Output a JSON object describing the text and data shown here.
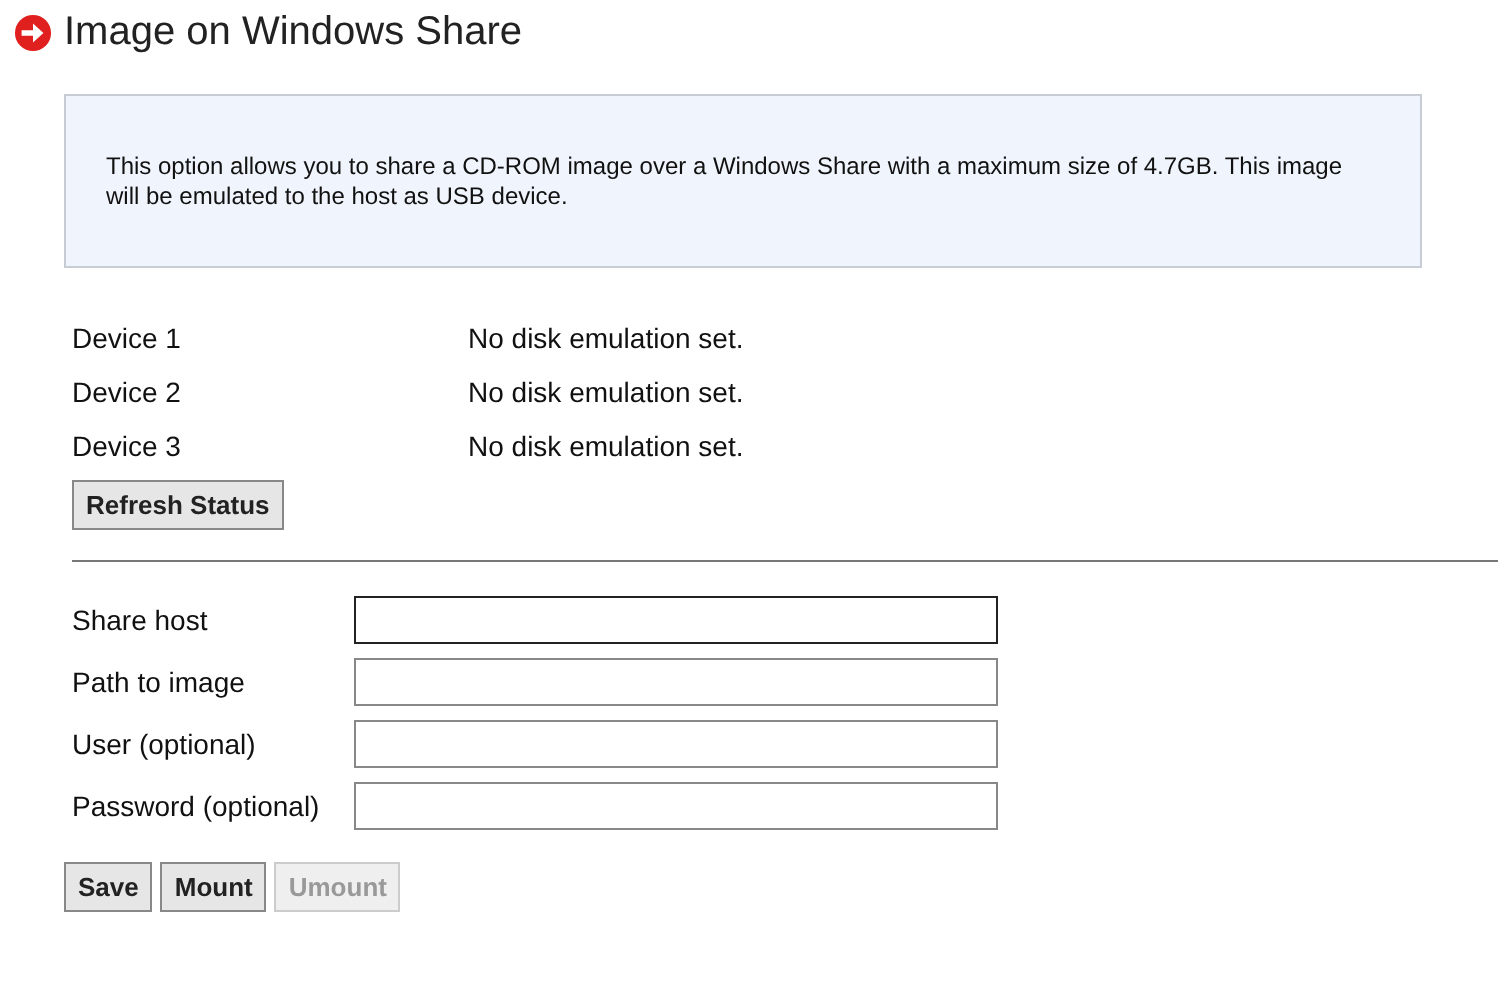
{
  "title": "Image on Windows Share",
  "info": "This option allows you to share a CD-ROM image over a Windows Share with a maximum size of 4.7GB. This image will be emulated to the host as USB device.",
  "devices": [
    {
      "name": "Device 1",
      "status": "No disk emulation set."
    },
    {
      "name": "Device 2",
      "status": "No disk emulation set."
    },
    {
      "name": "Device 3",
      "status": "No disk emulation set."
    }
  ],
  "refresh_button": "Refresh Status",
  "fields": [
    {
      "label": "Share host",
      "focused": true
    },
    {
      "label": "Path to image",
      "focused": false
    },
    {
      "label": "User (optional)",
      "focused": false
    },
    {
      "label": "Password (optional)",
      "focused": false
    }
  ],
  "buttons": [
    {
      "label": "Save",
      "disabled": false
    },
    {
      "label": "Mount",
      "disabled": false
    },
    {
      "label": "Umount",
      "disabled": true
    }
  ]
}
